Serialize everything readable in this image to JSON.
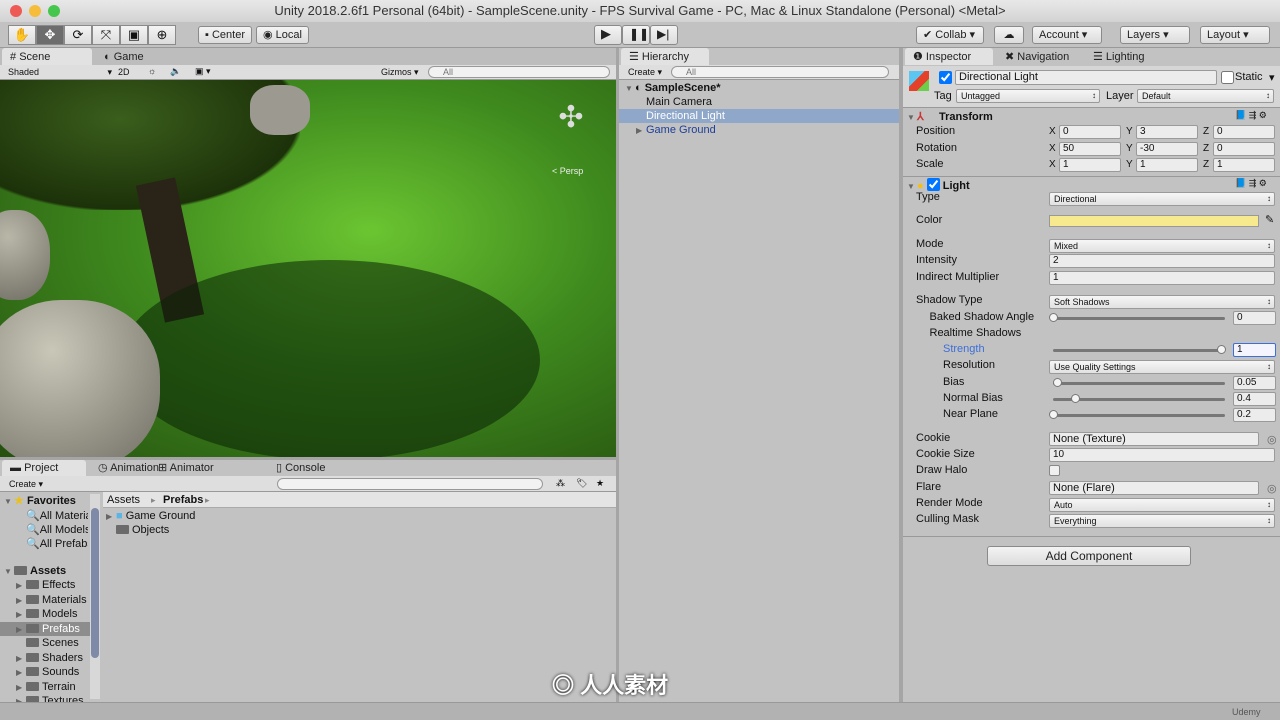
{
  "window": {
    "title": "Unity 2018.2.6f1 Personal (64bit) - SampleScene.unity - FPS Survival Game - PC, Mac & Linux Standalone (Personal) <Metal>"
  },
  "toolbar": {
    "tools": [
      "hand-tool",
      "move-tool",
      "rotate-tool",
      "scale-tool",
      "rect-tool",
      "transform-tool"
    ],
    "center": "Center",
    "local": "Local",
    "collab": "Collab",
    "account": "Account",
    "layers": "Layers",
    "layout": "Layout"
  },
  "scene": {
    "tabs": [
      "Scene",
      "Game"
    ],
    "shading": "Shaded",
    "mode2d": "2D",
    "gizmos": "Gizmos",
    "search_placeholder": "All",
    "persp": "< Persp"
  },
  "hierarchy": {
    "tab": "Hierarchy",
    "create": "Create",
    "search_placeholder": "All",
    "scene": "SampleScene*",
    "items": [
      "Main Camera",
      "Directional Light",
      "Game Ground"
    ]
  },
  "project": {
    "tabs": [
      "Project",
      "Animation",
      "Animator",
      "Console"
    ],
    "create": "Create",
    "favorites_label": "Favorites",
    "favorites": [
      "All Materials",
      "All Models",
      "All Prefabs"
    ],
    "assets_label": "Assets",
    "folders": [
      "Effects",
      "Materials",
      "Models",
      "Prefabs",
      "Scenes",
      "Shaders",
      "Sounds",
      "Terrain",
      "Textures"
    ],
    "breadcrumb": [
      "Assets",
      "Prefabs"
    ],
    "contents": [
      "Game Ground",
      "Objects"
    ]
  },
  "inspector": {
    "tabs": [
      "Inspector",
      "Navigation",
      "Lighting"
    ],
    "object_name": "Directional Light",
    "static_label": "Static",
    "tag_label": "Tag",
    "tag": "Untagged",
    "layer_label": "Layer",
    "layer": "Default",
    "transform": {
      "title": "Transform",
      "rows": [
        {
          "label": "Position",
          "x": "0",
          "y": "3",
          "z": "0"
        },
        {
          "label": "Rotation",
          "x": "50",
          "y": "-30",
          "z": "0"
        },
        {
          "label": "Scale",
          "x": "1",
          "y": "1",
          "z": "1"
        }
      ]
    },
    "light": {
      "title": "Light",
      "color": "#f7e98e",
      "rows": [
        {
          "label": "Type",
          "kind": "drop",
          "value": "Directional"
        },
        {
          "label": "Color",
          "kind": "color"
        },
        {
          "label": "Mode",
          "kind": "drop",
          "value": "Mixed"
        },
        {
          "label": "Intensity",
          "kind": "field",
          "value": "2"
        },
        {
          "label": "Indirect Multiplier",
          "kind": "field",
          "value": "1"
        },
        {
          "label": "Shadow Type",
          "kind": "drop",
          "value": "Soft Shadows"
        },
        {
          "label": "Baked Shadow Angle",
          "kind": "slider",
          "value": "0",
          "fraction": 0,
          "indent": 1
        },
        {
          "label": "Realtime Shadows",
          "kind": "label",
          "indent": 1
        },
        {
          "label": "Strength",
          "kind": "slider",
          "value": "1",
          "fraction": 1,
          "indent": 2,
          "active": true
        },
        {
          "label": "Resolution",
          "kind": "drop",
          "value": "Use Quality Settings",
          "indent": 2
        },
        {
          "label": "Bias",
          "kind": "slider",
          "value": "0.05",
          "fraction": 0.025,
          "indent": 2
        },
        {
          "label": "Normal Bias",
          "kind": "slider",
          "value": "0.4",
          "fraction": 0.13,
          "indent": 2
        },
        {
          "label": "Near Plane",
          "kind": "slider",
          "value": "0.2",
          "fraction": 0,
          "indent": 2
        },
        {
          "label": "Cookie",
          "kind": "object",
          "value": "None (Texture)"
        },
        {
          "label": "Cookie Size",
          "kind": "field",
          "value": "10"
        },
        {
          "label": "Draw Halo",
          "kind": "check"
        },
        {
          "label": "Flare",
          "kind": "object",
          "value": "None (Flare)"
        },
        {
          "label": "Render Mode",
          "kind": "drop",
          "value": "Auto"
        },
        {
          "label": "Culling Mask",
          "kind": "drop",
          "value": "Everything"
        }
      ]
    },
    "add_component": "Add Component"
  },
  "colors": {
    "accent": "#3d6fd8",
    "selection": "#8fa7c9",
    "grass": "#3f8a1e"
  },
  "watermark": "人人素材",
  "udemy": "Udemy"
}
